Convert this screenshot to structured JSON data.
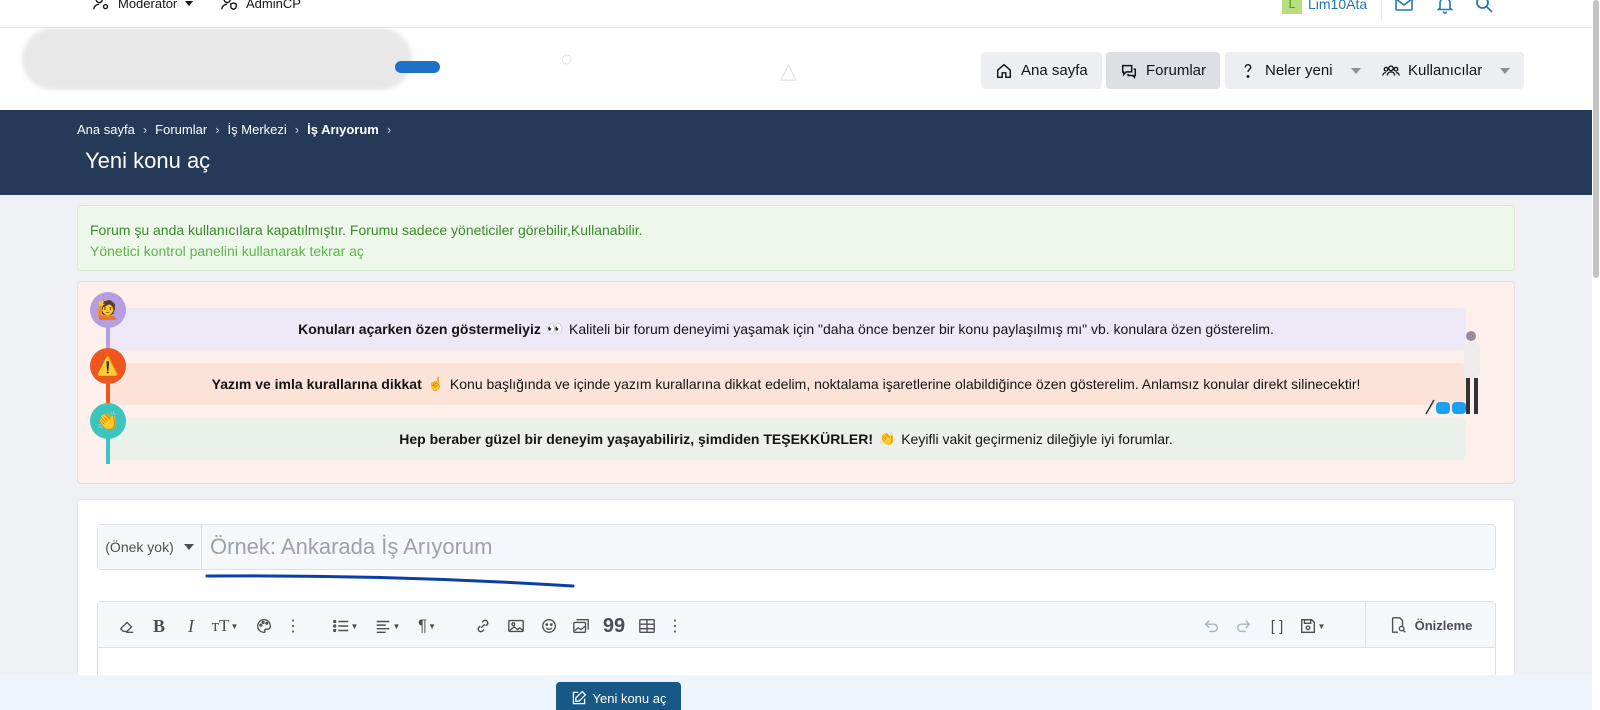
{
  "staffbar": {
    "moderator_label": "Moderatör",
    "admincp_label": "AdminCP",
    "username": "Lim10Ata",
    "avatar_letter": "L"
  },
  "nav": {
    "home": "Ana sayfa",
    "forums": "Forumlar",
    "whats_new": "Neler yeni",
    "members": "Kullanıcılar"
  },
  "breadcrumb": {
    "items": [
      "Ana sayfa",
      "Forumlar",
      "İş Merkezi",
      "İş Arıyorum"
    ]
  },
  "page": {
    "title": "Yeni konu aç"
  },
  "notice_closed": {
    "line1": "Forum şu anda kullanıcılara kapatılmıştır. Forumu sadece yöneticiler görebilir,Kullanabilir.",
    "line2": "Yönetici kontrol panelini kullanarak tekrar aç"
  },
  "rules": [
    {
      "bold": "Konuları açarken özen göstermeliyiz",
      "emoji": "👀",
      "text": "Kaliteli bir forum deneyimi yaşamak için \"daha önce benzer bir konu paylaşılmış mı\" vb. konulara özen gösterelim.",
      "icon_emoji": "🙋",
      "bg": "#ece8f6",
      "icon_bg": "#b59fe0"
    },
    {
      "bold": "Yazım ve imla kurallarına dikkat",
      "emoji": "☝",
      "text": "Konu başlığında ve içinde yazım kurallarına dikkat edelim, noktalama işaretlerine olabildiğince özen gösterelim. Anlamsız konular direkt silinecektir!",
      "icon_emoji": "⚠️",
      "bg": "#fbe3d7",
      "icon_bg": "#f0561f"
    },
    {
      "bold": "Hep beraber güzel bir deneyim yaşayabiliriz, şimdiden TEŞEKKÜRLER!",
      "emoji": "👏",
      "text": "Keyifli vakit geçirmeniz dileğiyle iyi forumlar.",
      "icon_emoji": "👏",
      "bg": "#e9f1ea",
      "icon_bg": "#3cc4bd"
    }
  ],
  "form": {
    "prefix": "(Önek yok)",
    "title_placeholder": "Örnek: Ankarada İş Arıyorum",
    "preview_label": "Önizleme",
    "submit_label": "Yeni konu aç"
  },
  "colors": {
    "band": "#253a59",
    "accent": "#2577b1",
    "submit": "#185886"
  }
}
